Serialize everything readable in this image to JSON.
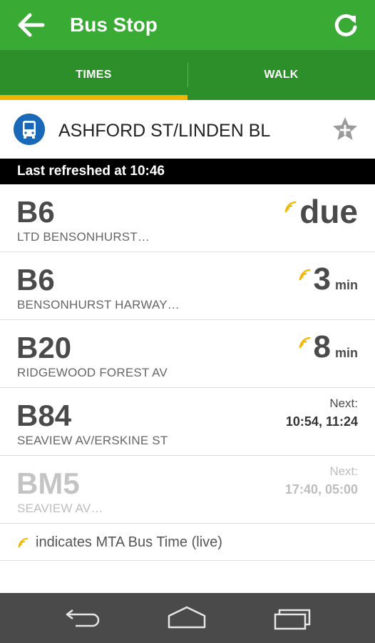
{
  "appbar": {
    "title": "Bus Stop",
    "back_icon": "arrow-left-icon",
    "refresh_icon": "refresh-icon"
  },
  "tabs": [
    {
      "label": "TIMES",
      "selected": true
    },
    {
      "label": "WALK",
      "selected": false
    }
  ],
  "stop": {
    "name": "ASHFORD ST/LINDEN BL",
    "icon": "bus-icon",
    "favorite_icon": "star-add-icon"
  },
  "status": {
    "last_refreshed": "Last refreshed at 10:46"
  },
  "routes": [
    {
      "route": "B6",
      "destination": "LTD BENSONHURST…",
      "live": true,
      "arrival": "due",
      "unit": ""
    },
    {
      "route": "B6",
      "destination": "BENSONHURST HARWAY…",
      "live": true,
      "arrival": "3",
      "unit": "min"
    },
    {
      "route": "B20",
      "destination": "RIDGEWOOD FOREST AV",
      "live": true,
      "arrival": "8",
      "unit": "min"
    },
    {
      "route": "B84",
      "destination": "SEAVIEW AV/ERSKINE ST",
      "live": false,
      "next_label": "Next:",
      "next_times": "10:54, 11:24"
    },
    {
      "route": "BM5",
      "destination": "SEAVIEW AV…",
      "live": false,
      "next_label": "Next:",
      "next_times": "17:40, 05:00",
      "muted": true
    }
  ],
  "legend": {
    "text": "indicates MTA Bus Time (live)",
    "icon": "live-signal-icon"
  },
  "colors": {
    "appbar": "#39ab35",
    "tabbar": "#2d8f2a",
    "tab_indicator": "#f2b500",
    "live_icon": "#f2b500",
    "bus_icon_bg": "#1a68b8",
    "navbar": "#4a4a4a"
  },
  "navbar": {
    "back_icon": "nav-back-icon",
    "home_icon": "nav-home-icon",
    "recents_icon": "nav-recents-icon"
  }
}
